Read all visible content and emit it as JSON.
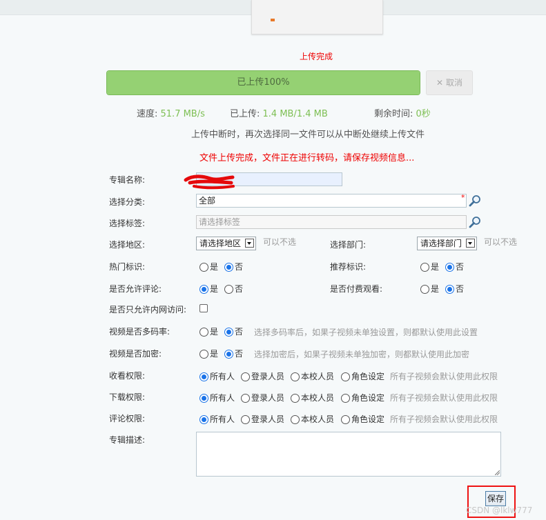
{
  "upload": {
    "status": "上传完成",
    "progress_label": "已上传100%",
    "progress_fraction": 1.0,
    "cancel_label": "取消",
    "speed_label": "速度: ",
    "speed_value": "51.7 MB/s",
    "uploaded_label": "已上传: ",
    "uploaded_value": "1.4 MB/1.4 MB",
    "remaining_label": "剩余时间: ",
    "remaining_value": "0秒",
    "resume_tip": "上传中断时，再次选择同一文件可以从中断处继续上传文件",
    "transcode_tip": "文件上传完成，文件正在进行转码，请保存视频信息..."
  },
  "form": {
    "album_name_label": "专辑名称:",
    "category_label": "选择分类:",
    "category_value": "全部",
    "required_mark": "*",
    "tags_label": "选择标签:",
    "tags_placeholder": "请选择标签",
    "region_label": "选择地区:",
    "region_select": "请选择地区",
    "optional_text": "可以不选",
    "dept_label": "选择部门:",
    "dept_select": "请选择部门",
    "hot_label": "热门标识:",
    "recommend_label": "推荐标识:",
    "allow_comment_label": "是否允许评论:",
    "paid_label": "是否付费观看:",
    "intranet_label": "是否只允许内网访问:",
    "multi_bitrate_label": "视频是否多码率:",
    "multi_bitrate_hint": "选择多码率后，如果子视频未单独设置，则都默认使用此设置",
    "encrypt_label": "视频是否加密:",
    "encrypt_hint": "选择加密后，如果子视频未单独加密，则都默认使用此加密",
    "yes": "是",
    "no": "否",
    "view_perm_label": "收看权限:",
    "download_perm_label": "下载权限:",
    "comment_perm_label": "评论权限:",
    "perm_all": "所有人",
    "perm_login": "登录人员",
    "perm_school": "本校人员",
    "perm_role": "角色设定",
    "perm_hint": "所有子视频会默认使用此权限",
    "desc_label": "专辑描述:",
    "save_label": "保存"
  },
  "watermark": "CSDN @lklw777",
  "colors": {
    "progress": "#95d173",
    "error_text": "#e00000",
    "radio_checked": "#1a73e8",
    "highlight_box": "#e11111"
  },
  "icons": [
    "magnifier-icon",
    "close-icon",
    "file-icon",
    "dropdown-arrow-icon"
  ]
}
